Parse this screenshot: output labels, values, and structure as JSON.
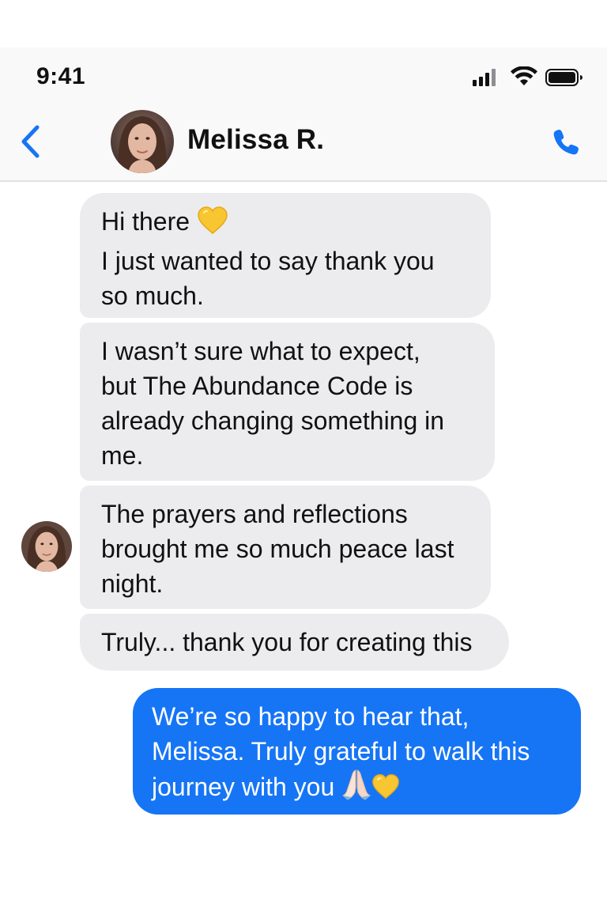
{
  "status_bar": {
    "time": "9:41",
    "icons": [
      "cellular-signal-icon",
      "wifi-icon",
      "battery-icon"
    ]
  },
  "header": {
    "back_icon": "chevron-left-icon",
    "contact_name": "Melissa R.",
    "call_icon": "phone-icon",
    "accent_color": "#1675f5"
  },
  "messages": [
    {
      "direction": "received",
      "lines": [
        "Hi there",
        "I just wanted to say thank you",
        "so much."
      ],
      "emojis": [
        "yellow-heart"
      ]
    },
    {
      "direction": "received",
      "lines": [
        "I wasn’t sure what to expect,",
        "but The Abundance Code is",
        "already changing something in",
        "me."
      ]
    },
    {
      "direction": "received",
      "lines": [
        "The prayers and reflections",
        "brought me so much peace last",
        "night."
      ]
    },
    {
      "direction": "received",
      "lines": [
        "Truly... thank you for creating this"
      ]
    },
    {
      "direction": "sent",
      "lines": [
        "We’re so happy to hear that,",
        "Melissa. Truly grateful to walk this",
        "journey with you"
      ],
      "emojis": [
        "folded-hands",
        "yellow-heart"
      ]
    }
  ],
  "colors": {
    "received_bubble": "#ececee",
    "sent_bubble": "#1675f5",
    "bar_background": "#f9f9f9"
  }
}
